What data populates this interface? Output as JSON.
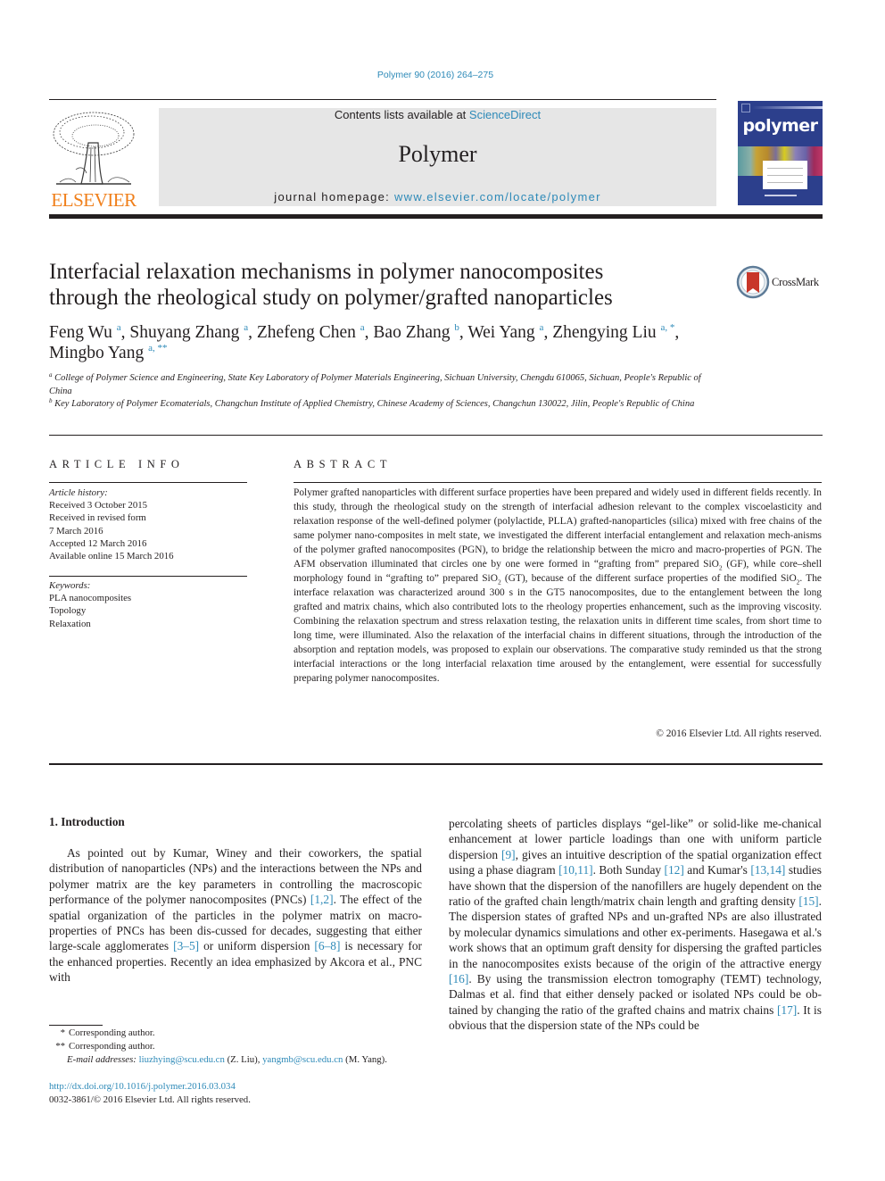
{
  "header": {
    "citation": "Polymer 90 (2016) 264–275",
    "publisher_logo_text": "ELSEVIER",
    "contents_prefix": "Contents lists available at ",
    "contents_link": "ScienceDirect",
    "journal_name": "Polymer",
    "homepage_prefix": "journal homepage: ",
    "homepage_link": "www.elsevier.com/locate/polymer",
    "cover_title": "polymer"
  },
  "article": {
    "title_line1": "Interfacial relaxation mechanisms in polymer nanocomposites",
    "title_line2": "through the rheological study on polymer/grafted nanoparticles",
    "crossmark_label": "CrossMark",
    "authors": [
      {
        "name": "Feng Wu",
        "sup": "a",
        "sep": ", "
      },
      {
        "name": "Shuyang Zhang",
        "sup": "a",
        "sep": ", "
      },
      {
        "name": "Zhefeng Chen",
        "sup": "a",
        "sep": ", "
      },
      {
        "name": "Bao Zhang",
        "sup": "b",
        "sep": ", "
      },
      {
        "name": "Wei Yang",
        "sup": "a",
        "sep": ", "
      },
      {
        "name": "Zhengying Liu",
        "sup": "a, *",
        "sep": ","
      },
      {
        "name": "Mingbo Yang",
        "sup": "a, **",
        "sep": ""
      }
    ],
    "affiliations": [
      {
        "mark": "a",
        "text": "College of Polymer Science and Engineering, State Key Laboratory of Polymer Materials Engineering, Sichuan University, Chengdu 610065, Sichuan, People's Republic of China"
      },
      {
        "mark": "b",
        "text": "Key Laboratory of Polymer Ecomaterials, Changchun Institute of Applied Chemistry, Chinese Academy of Sciences, Changchun 130022, Jilin, People's Republic of China"
      }
    ]
  },
  "article_info": {
    "label": "ARTICLE INFO",
    "history_head": "Article history:",
    "history": [
      "Received 3 October 2015",
      "Received in revised form",
      "7 March 2016",
      "Accepted 12 March 2016",
      "Available online 15 March 2016"
    ],
    "keywords_head": "Keywords:",
    "keywords": [
      "PLA nanocomposites",
      "Topology",
      "Relaxation"
    ]
  },
  "abstract": {
    "label": "ABSTRACT",
    "part1": "Polymer grafted nanoparticles with different surface properties have been prepared and widely used in different fields recently. In this study, through the rheological study on the strength of interfacial adhesion relevant to the complex viscoelasticity and relaxation response of the well-defined polymer (polylactide, PLLA) grafted-nanoparticles (silica) mixed with free chains of the same polymer nano-composites in melt state, we investigated the different interfacial entanglement and relaxation mech-anisms of the polymer grafted nanocomposites (PGN), to bridge the relationship between the micro and macro-properties of PGN. The AFM observation illuminated that circles one by one were formed in “grafting from” prepared SiO",
    "part2": " (GF), while core–shell morphology found in “grafting to” prepared SiO",
    "part3": " (GT), because of the different surface properties of the modified SiO",
    "part4": ". The interface relaxation was characterized around 300 s in the GT5 nanocomposites, due to the entanglement between the long grafted and matrix chains, which also contributed lots to the rheology properties enhancement, such as the improving viscosity. Combining the relaxation spectrum and stress relaxation testing, the relaxation units in different time scales, from short time to long time, were illuminated. Also the relaxation of the interfacial chains in different situations, through the introduction of the absorption and reptation models, was proposed to explain our observations. The comparative study reminded us that the strong interfacial interactions or the long interfacial relaxation time aroused by the entanglement, were essential for successfully preparing polymer nanocomposites.",
    "subscript": "2",
    "copyright": "© 2016 Elsevier Ltd. All rights reserved."
  },
  "body": {
    "section_heading": "1.  Introduction",
    "left": [
      {
        "t": "As pointed out by Kumar, Winey and their coworkers, the spatial distribution of nanoparticles (NPs) and the interactions between the NPs and polymer matrix are the key parameters in controlling the macroscopic performance of the polymer nanocomposites (PNCs) "
      },
      {
        "ref": "[1,2]"
      },
      {
        "t": ". The effect of the spatial organization of the particles in the polymer matrix on macro-properties of PNCs has been dis-cussed for decades, suggesting that either large-scale agglomerates "
      },
      {
        "ref": "[3–5]"
      },
      {
        "t": " or uniform dispersion "
      },
      {
        "ref": "[6–8]"
      },
      {
        "t": " is necessary for the enhanced properties. Recently an idea emphasized by Akcora et al., PNC with"
      }
    ],
    "right": [
      {
        "t": "percolating sheets of particles displays “gel-like” or solid-like me-chanical enhancement at lower particle loadings than one with uniform particle dispersion "
      },
      {
        "ref": "[9]"
      },
      {
        "t": ", gives an intuitive description of the spatial organization effect using a phase diagram "
      },
      {
        "ref": "[10,11]"
      },
      {
        "t": ". Both Sunday "
      },
      {
        "ref": "[12]"
      },
      {
        "t": " and Kumar's "
      },
      {
        "ref": "[13,14]"
      },
      {
        "t": " studies have shown that the dispersion of the nanofillers are hugely dependent on the ratio of the grafted chain length/matrix chain length and grafting density "
      },
      {
        "ref": "[15]"
      },
      {
        "t": ". The dispersion states of grafted NPs and un-grafted NPs are also illustrated by molecular dynamics simulations and other ex-periments. Hasegawa et al.'s work shows that an optimum graft density for dispersing the grafted particles in the nanocomposites exists because of the origin of the attractive energy "
      },
      {
        "ref": "[16]"
      },
      {
        "t": ". By using the transmission electron tomography (TEMT) technology, Dalmas et al. find that either densely packed or isolated NPs could be ob-tained by changing the ratio of the grafted chains and matrix chains "
      },
      {
        "ref": "[17]"
      },
      {
        "t": ". It is obvious that the dispersion state of the NPs could be"
      }
    ]
  },
  "footnotes": {
    "fn1_mark": "*",
    "fn1_text": "Corresponding author.",
    "fn2_mark": "**",
    "fn2_text": "Corresponding author.",
    "email_label": "E-mail addresses:",
    "email1": "liuzhying@scu.edu.cn",
    "email1_owner": " (Z. Liu), ",
    "email2": "yangmb@scu.edu.cn",
    "email2_owner": " (M. Yang).",
    "doi": "http://dx.doi.org/10.1016/j.polymer.2016.03.034",
    "issn_rights": "0032-3861/© 2016 Elsevier Ltd. All rights reserved."
  },
  "colors": {
    "link": "#2e8ab8",
    "elsevier_orange": "#f07f1a",
    "journal_box": "#e6e6e6",
    "cover_blue": "#2c3f8c"
  }
}
